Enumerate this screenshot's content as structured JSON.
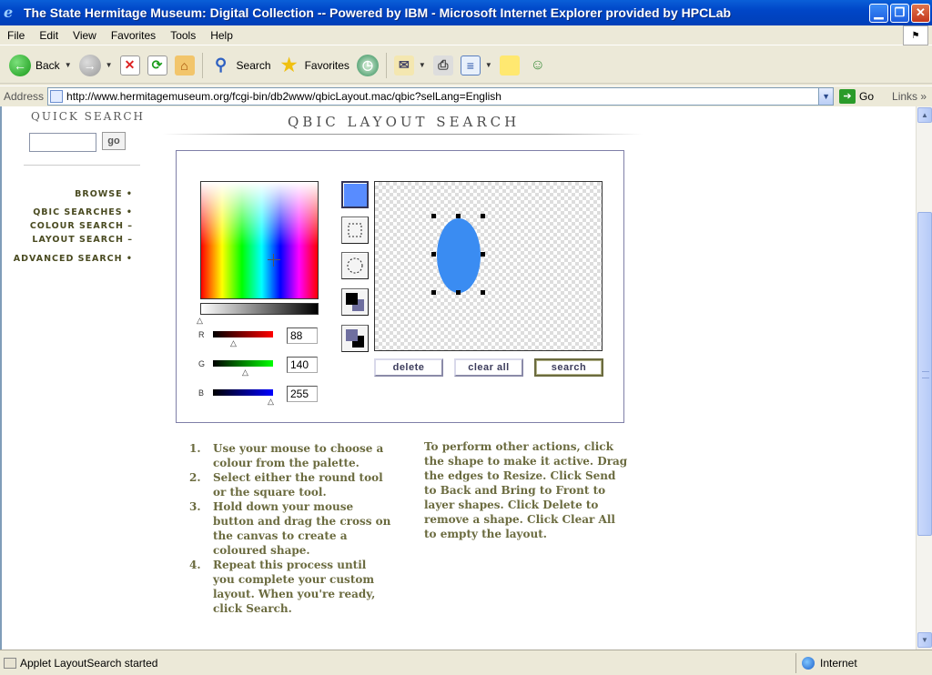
{
  "window": {
    "title": "The State Hermitage Museum: Digital Collection -- Powered by IBM - Microsoft Internet Explorer provided by HPCLab"
  },
  "menu": [
    "File",
    "Edit",
    "View",
    "Favorites",
    "Tools",
    "Help"
  ],
  "toolbar": {
    "back": "Back",
    "search": "Search",
    "favorites": "Favorites"
  },
  "address": {
    "label": "Address",
    "url": "http://www.hermitagemuseum.org/fcgi-bin/db2www/qbicLayout.mac/qbic?selLang=English",
    "go": "Go",
    "links": "Links"
  },
  "sidebar": {
    "quick_search": "QUICK SEARCH",
    "go": "go",
    "nav": [
      {
        "label": "BROWSE",
        "marker": "•"
      },
      {
        "label": "QBIC SEARCHES",
        "marker": "•"
      },
      {
        "label": "COLOUR SEARCH",
        "marker": "–"
      },
      {
        "label": "LAYOUT SEARCH",
        "marker": "–"
      },
      {
        "label": "ADVANCED SEARCH",
        "marker": "•"
      }
    ]
  },
  "main": {
    "title": "QBIC LAYOUT SEARCH",
    "rgb": {
      "r_label": "R",
      "g_label": "G",
      "b_label": "B",
      "r": "88",
      "g": "140",
      "b": "255"
    },
    "selected_color": "#588cff",
    "shape_color": "#3a8cf2",
    "buttons": {
      "delete": "delete",
      "clear_all": "clear all",
      "search": "search"
    },
    "instructions": [
      "Use your mouse to choose a colour from the palette.",
      "Select either the round tool or the square tool.",
      "Hold down your mouse button and drag the cross on the canvas to create a coloured shape.",
      "Repeat this process until you complete your custom layout. When you're ready, click Search."
    ],
    "other_actions": "To perform other actions, click the shape to make it active. Drag the edges to Resize. Click Send to Back and Bring to Front to layer shapes. Click Delete to remove a shape. Click Clear All to empty the layout."
  },
  "status": {
    "message": "Applet LayoutSearch started",
    "zone": "Internet"
  }
}
